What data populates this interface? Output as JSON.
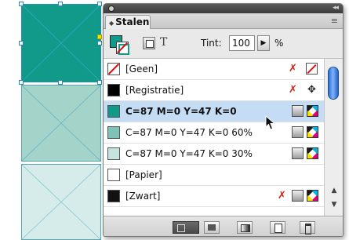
{
  "canvas": {
    "frame_colors": [
      "#11998a",
      "#a4d3c9",
      "#d6ecea"
    ]
  },
  "panel": {
    "tab_label": "Stalen",
    "tint_label": "Tint:",
    "tint_value": "100",
    "tint_unit": "%",
    "text_button_glyph": "T",
    "menu_glyph": "≡",
    "collapse_glyph": "◂◂",
    "fill_color": "#11998a",
    "swatches": [
      {
        "name": "[Geen]",
        "color": "none",
        "icons": [
          "noedit-icon",
          "none-swatch-icon"
        ]
      },
      {
        "name": "[Registratie]",
        "color": "#000000",
        "icons": [
          "noedit-icon",
          "registration-icon"
        ]
      },
      {
        "name": "C=87 M=0 Y=47 K=0",
        "color": "#11998a",
        "selected": true,
        "icons": [
          "process-color-icon",
          "cmyk-icon"
        ]
      },
      {
        "name": "C=87 M=0 Y=47 K=0 60%",
        "color": "#7fc3b8",
        "icons": [
          "process-color-icon",
          "cmyk-icon"
        ]
      },
      {
        "name": "C=87 M=0 Y=47 K=0 30%",
        "color": "#c4e4dd",
        "icons": [
          "process-color-icon",
          "cmyk-icon"
        ]
      },
      {
        "name": "[Papier]",
        "color": "#ffffff",
        "icons": []
      },
      {
        "name": "[Zwart]",
        "color": "#111111",
        "icons": [
          "noedit-icon",
          "process-color-icon",
          "cmyk-icon"
        ]
      }
    ],
    "noedit_glyph": "✗",
    "registration_glyph": "✥",
    "scroll_up": "▲",
    "scroll_down": "▼"
  }
}
